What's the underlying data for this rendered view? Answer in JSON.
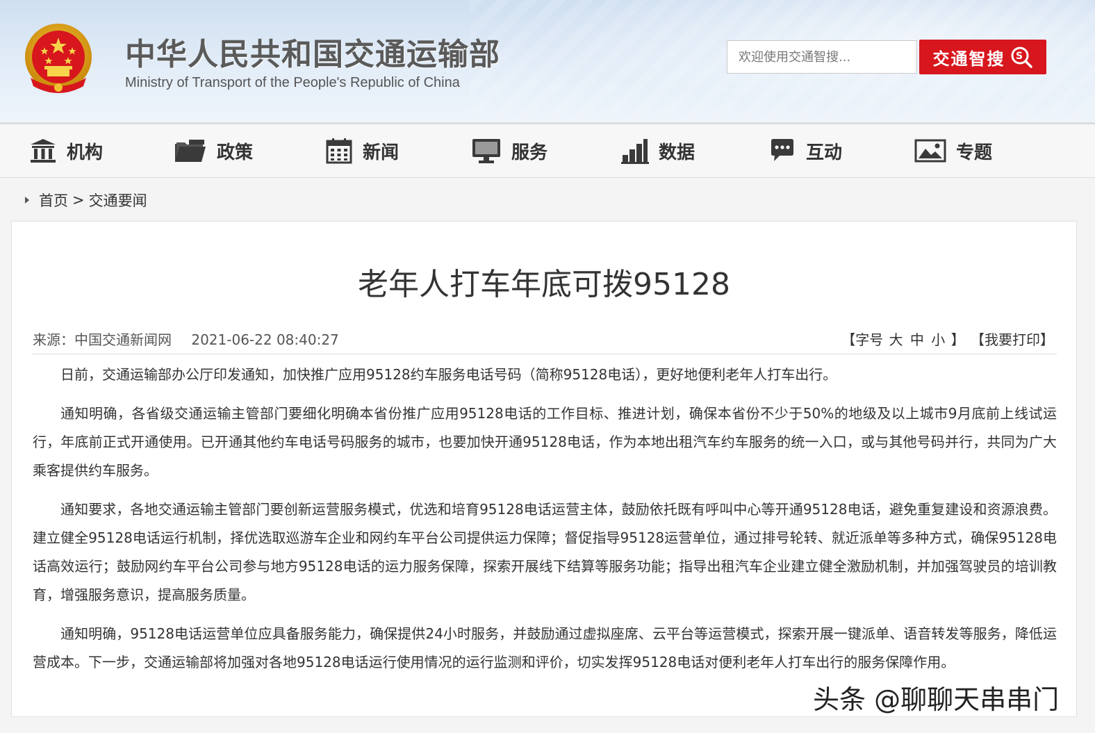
{
  "header": {
    "title": "中华人民共和国交通运输部",
    "subtitle": "Ministry of Transport of the People's Republic of China",
    "search_placeholder": "欢迎使用交通智搜...",
    "search_button": "交通智搜",
    "emblem_icon": "national-emblem-icon"
  },
  "nav": {
    "items": [
      {
        "label": "机构",
        "icon": "building-icon"
      },
      {
        "label": "政策",
        "icon": "folder-icon"
      },
      {
        "label": "新闻",
        "icon": "calendar-icon"
      },
      {
        "label": "服务",
        "icon": "monitor-icon"
      },
      {
        "label": "数据",
        "icon": "bar-chart-icon"
      },
      {
        "label": "互动",
        "icon": "chat-bubble-icon"
      },
      {
        "label": "专题",
        "icon": "image-icon"
      }
    ]
  },
  "breadcrumb": {
    "home": "首页",
    "separator": ">",
    "current": "交通要闻"
  },
  "article": {
    "title": "老年人打车年底可拨95128",
    "source": "来源：中国交通新闻网",
    "date": "2021-06-22 08:40:27",
    "font_size_label": "【字号",
    "font_large": "大",
    "font_medium": "中",
    "font_small": "小",
    "font_size_close": "】",
    "print": "【我要打印】",
    "paragraphs": [
      "日前，交通运输部办公厅印发通知，加快推广应用95128约车服务电话号码（简称95128电话），更好地便利老年人打车出行。",
      "通知明确，各省级交通运输主管部门要细化明确本省份推广应用95128电话的工作目标、推进计划，确保本省份不少于50%的地级及以上城市9月底前上线试运行，年底前正式开通使用。已开通其他约车电话号码服务的城市，也要加快开通95128电话，作为本地出租汽车约车服务的统一入口，或与其他号码并行，共同为广大乘客提供约车服务。",
      "通知要求，各地交通运输主管部门要创新运营服务模式，优选和培育95128电话运营主体，鼓励依托既有呼叫中心等开通95128电话，避免重复建设和资源浪费。建立健全95128电话运行机制，择优选取巡游车企业和网约车平台公司提供运力保障；督促指导95128运营单位，通过排号轮转、就近派单等多种方式，确保95128电话高效运行；鼓励网约车平台公司参与地方95128电话的运力服务保障，探索开展线下结算等服务功能；指导出租汽车企业建立健全激励机制，并加强驾驶员的培训教育，增强服务意识，提高服务质量。",
      "通知明确，95128电话运营单位应具备服务能力，确保提供24小时服务，并鼓励通过虚拟座席、云平台等运营模式，探索开展一键派单、语音转发等服务，降低运营成本。下一步，交通运输部将加强对各地95128电话运行使用情况的运行监测和评价，切实发挥95128电话对便利老年人打车出行的服务保障作用。"
    ]
  },
  "watermark": "头条 @聊聊天串串门",
  "colors": {
    "brand_red": "#d7161d",
    "nav_icon": "#3a3a3a",
    "header_bg": "#dbe7f4"
  }
}
